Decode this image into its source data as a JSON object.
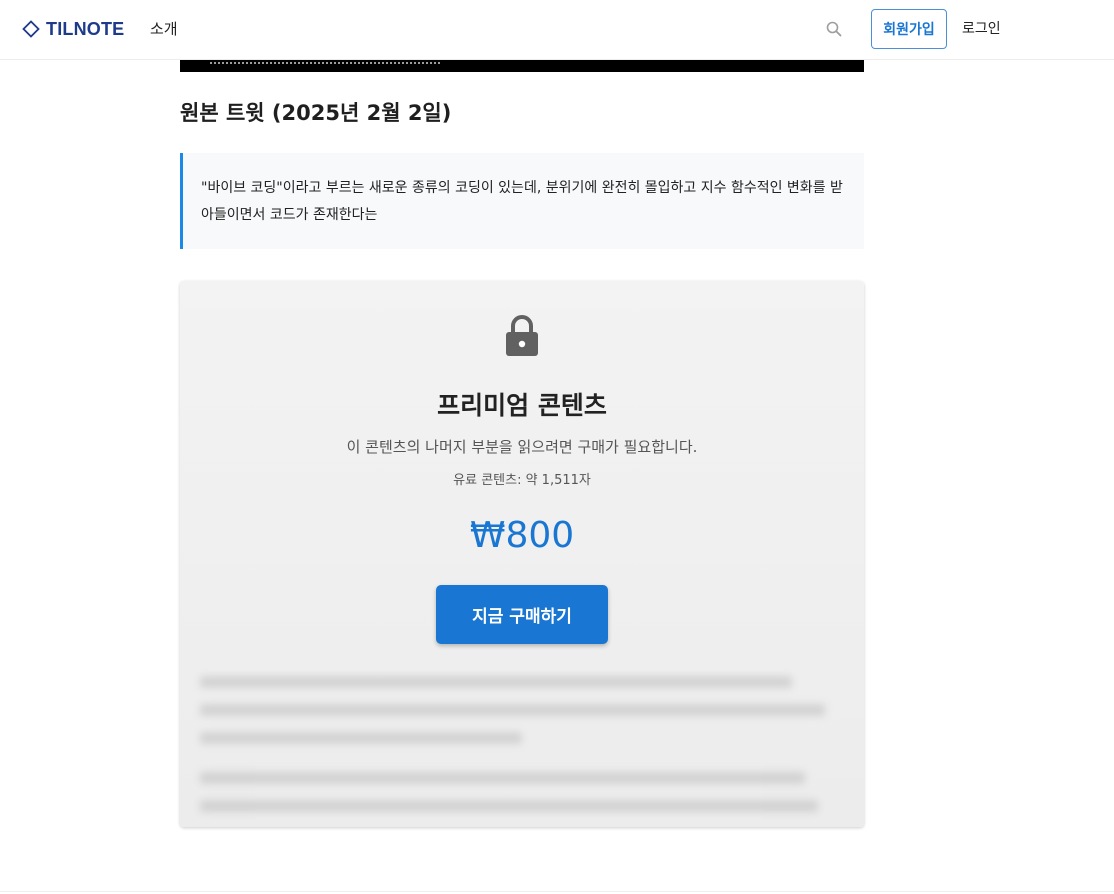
{
  "header": {
    "logo_text": "TILNOTE",
    "nav_intro": "소개",
    "signup_label": "회원가입",
    "login_label": "로그인",
    "icons": {
      "logo": "diamond-icon",
      "search": "search-icon"
    },
    "colors": {
      "logo": "#1e3a8a",
      "accent": "#1976d2"
    }
  },
  "article": {
    "section_title": "원본 트윗 (2025년 2월 2일)",
    "quote_text": "\"바이브 코딩\"이라고 부르는 새로운 종류의 코딩이 있는데, 분위기에 완전히 몰입하고 지수 함수적인 변화를 받아들이면서 코드가 존재한다는"
  },
  "premium": {
    "icon": "lock-icon",
    "title": "프리미엄 콘텐츠",
    "description": "이 콘텐츠의 나머지 부분을 읽으려면 구매가 필요합니다.",
    "meta": "유료 콘텐츠: 약 1,511자",
    "price": "₩800",
    "buy_label": "지금 구매하기",
    "colors": {
      "price": "#1976d2",
      "button": "#1976d2"
    }
  }
}
